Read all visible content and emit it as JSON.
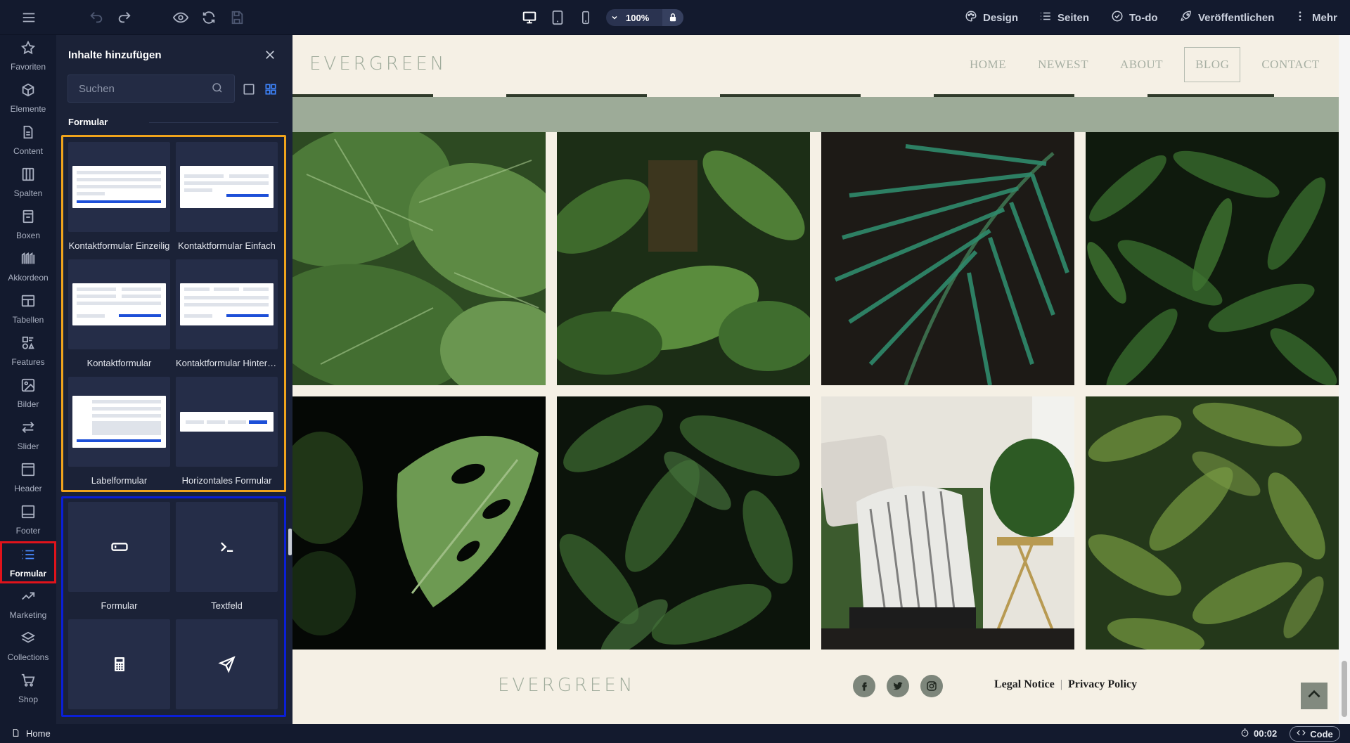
{
  "topbar": {
    "zoom_label": "100%",
    "nav": {
      "design": "Design",
      "pages": "Seiten",
      "todo": "To-do",
      "publish": "Veröffentlichen",
      "more": "Mehr"
    }
  },
  "sidebar": {
    "items": [
      {
        "label": "Favoriten"
      },
      {
        "label": "Elemente"
      },
      {
        "label": "Content"
      },
      {
        "label": "Spalten"
      },
      {
        "label": "Boxen"
      },
      {
        "label": "Akkordeon"
      },
      {
        "label": "Tabellen"
      },
      {
        "label": "Features"
      },
      {
        "label": "Bilder"
      },
      {
        "label": "Slider"
      },
      {
        "label": "Header"
      },
      {
        "label": "Footer"
      },
      {
        "label": "Formular"
      },
      {
        "label": "Marketing"
      },
      {
        "label": "Collections"
      },
      {
        "label": "Shop"
      }
    ],
    "active": "Formular"
  },
  "panel": {
    "title": "Inhalte hinzufügen",
    "search_placeholder": "Suchen",
    "section": "Formular",
    "templates": [
      {
        "label": "Kontaktformular Einzeilig"
      },
      {
        "label": "Kontaktformular Einfach"
      },
      {
        "label": "Kontaktformular"
      },
      {
        "label": "Kontaktformular Hintergrund"
      },
      {
        "label": "Labelformular"
      },
      {
        "label": "Horizontales Formular"
      }
    ],
    "elements": [
      {
        "label": "Formular",
        "icon": "input-field-icon"
      },
      {
        "label": "Textfeld",
        "icon": "terminal-icon"
      },
      {
        "label": "",
        "icon": "calculator-icon"
      },
      {
        "label": "",
        "icon": "send-icon"
      }
    ]
  },
  "site": {
    "logo": "EVERGREEN",
    "menu": [
      "HOME",
      "NEWEST",
      "ABOUT",
      "BLOG",
      "CONTACT"
    ],
    "active_menu": "BLOG",
    "footer": {
      "logo": "EVERGREEN",
      "legal": "Legal Notice",
      "privacy": "Privacy Policy",
      "separator": "|"
    }
  },
  "status": {
    "page": "Home",
    "timer": "00:02",
    "code": "Code"
  }
}
